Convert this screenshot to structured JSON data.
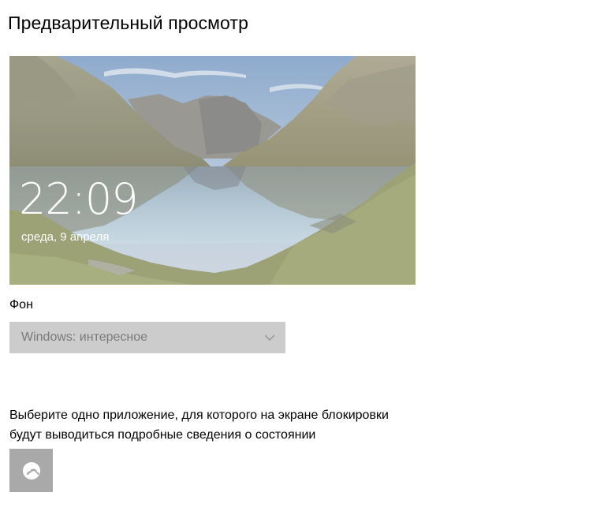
{
  "page": {
    "title": "Предварительный просмотр"
  },
  "preview": {
    "time": "22:09",
    "date": "среда, 9 апреля"
  },
  "background": {
    "label": "Фон",
    "selected": "Windows: интересное"
  },
  "app_status": {
    "description_line1": "Выберите одно приложение, для которого на экране блокировки",
    "description_line2": "будут выводиться подробные сведения о состоянии",
    "tile_icon": "weather-cloud-icon"
  },
  "colors": {
    "dropdown_bg": "#cccccc",
    "tile_bg": "#a9a9a9"
  }
}
